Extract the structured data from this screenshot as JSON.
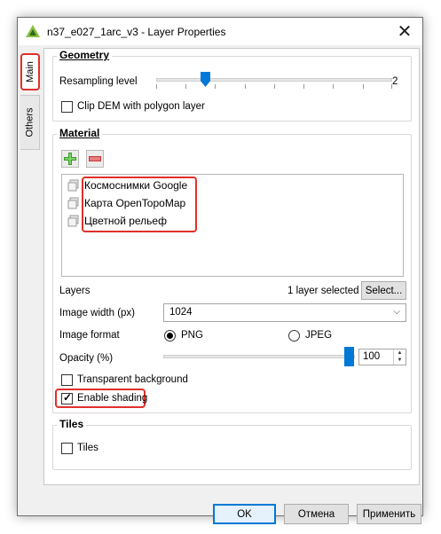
{
  "window": {
    "title": "n37_e027_1arc_v3 - Layer Properties",
    "close_glyph": "✕"
  },
  "tabs": [
    {
      "label": "Main",
      "selected": true
    },
    {
      "label": "Others",
      "selected": false
    }
  ],
  "geometry": {
    "title": "Geometry",
    "resampling_label": "Resampling level",
    "resampling_value": "2",
    "clip_label": "Clip DEM with polygon layer",
    "clip_checked": false
  },
  "material": {
    "title": "Material",
    "add_icon": "plus-icon",
    "remove_icon": "minus-icon",
    "items": [
      {
        "label": "Космоснимки Google"
      },
      {
        "label": "Карта OpenTopoMap"
      },
      {
        "label": "Цветной рельеф"
      }
    ],
    "layers_label": "Layers",
    "layers_selected": "1 layer selected",
    "select_button": "Select...",
    "image_width_label": "Image width (px)",
    "image_width_value": "1024",
    "image_format_label": "Image format",
    "format_png": "PNG",
    "format_jpeg": "JPEG",
    "format_selected": "PNG",
    "opacity_label": "Opacity (%)",
    "opacity_value": "100",
    "transparent_label": "Transparent background",
    "transparent_checked": false,
    "shading_label": "Enable shading",
    "shading_checked": true
  },
  "tiles": {
    "title": "Tiles",
    "tiles_label": "Tiles",
    "tiles_checked": false
  },
  "footer": {
    "ok": "OK",
    "cancel": "Отмена",
    "apply": "Применить"
  },
  "colors": {
    "accent": "#0078d7",
    "highlight": "#e0302b"
  }
}
